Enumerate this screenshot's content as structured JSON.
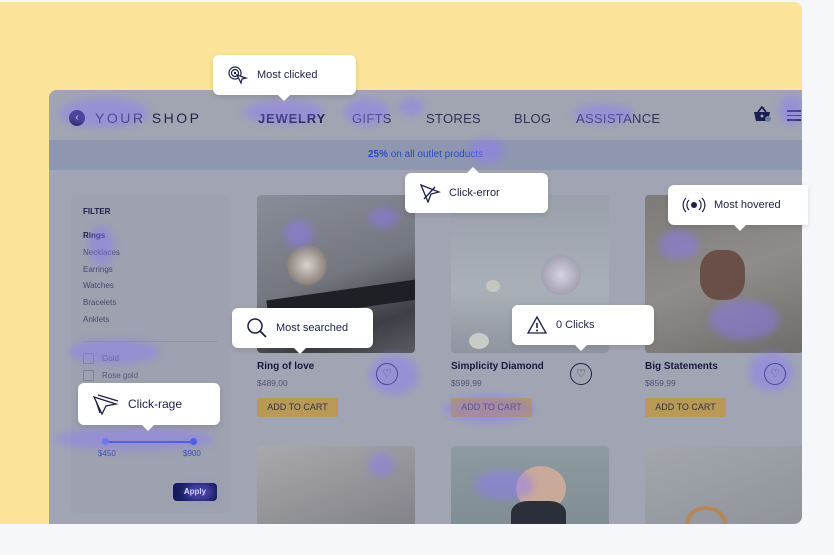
{
  "shop": {
    "logo_text": "YOUR SHOP",
    "nav": [
      {
        "label": "JEWELRY",
        "active": true
      },
      {
        "label": "GIFTS"
      },
      {
        "label": "STORES"
      },
      {
        "label": "BLOG"
      },
      {
        "label": "ASSISTANCE"
      }
    ],
    "promo": {
      "bold": "25%",
      "text": " on all outlet products"
    },
    "filter": {
      "title": "FILTER",
      "categories": [
        "Rings",
        "Necklaces",
        "Earrings",
        "Watches",
        "Bracelets",
        "Anklets"
      ],
      "active_category": "Rings",
      "materials": [
        "Gold",
        "Rose gold"
      ],
      "price_min": "$450",
      "price_max": "$900",
      "apply_label": "Apply"
    },
    "products": [
      {
        "name": "Ring of love",
        "price": "$489,00",
        "cart_label": "ADD TO CART"
      },
      {
        "name": "Simplicity Diamond",
        "price": "$599,99",
        "cart_label": "ADD TO CART"
      },
      {
        "name": "Big Statements",
        "price": "$859,99",
        "cart_label": "ADD TO CART"
      }
    ]
  },
  "tooltips": {
    "most_clicked": "Most clicked",
    "click_error": "Click-error",
    "most_hovered": "Most hovered",
    "most_searched": "Most searched",
    "zero_clicks": "0 Clicks",
    "click_rage": "Click-rage"
  },
  "colors": {
    "background_card": "#fce39a",
    "heatmap": "#8c78ff",
    "primary_dark": "#141b5e",
    "cart_button": "#b89a56"
  }
}
